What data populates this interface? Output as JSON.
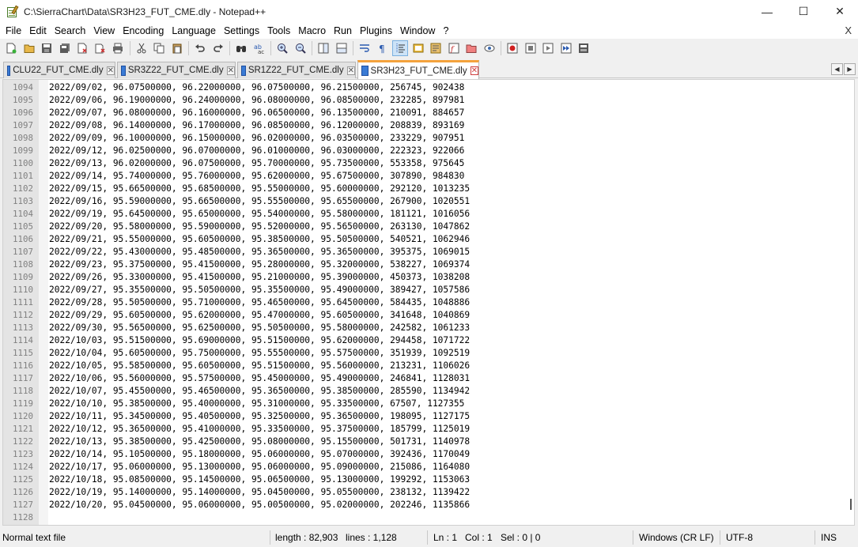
{
  "window": {
    "title": "C:\\SierraChart\\Data\\SR3H23_FUT_CME.dly - Notepad++",
    "minimize_glyph": "—",
    "maximize_glyph": "☐",
    "close_glyph": "✕"
  },
  "menu": {
    "items": [
      "File",
      "Edit",
      "Search",
      "View",
      "Encoding",
      "Language",
      "Settings",
      "Tools",
      "Macro",
      "Run",
      "Plugins",
      "Window",
      "?"
    ],
    "close_label": "X"
  },
  "toolbar": {
    "buttons": [
      "new-file",
      "open-file",
      "save",
      "save-all",
      "close",
      "close-all",
      "print",
      "cut",
      "copy",
      "paste",
      "undo",
      "redo",
      "find",
      "replace",
      "zoom-in",
      "zoom-out",
      "sync-vertical",
      "sync-horizontal",
      "word-wrap",
      "show-all-chars",
      "indent-guide",
      "define-language",
      "document-map",
      "function-list",
      "folder-workspace",
      "monitoring",
      "record-macro",
      "stop-recording",
      "playback-macro",
      "run-macro-multiple",
      "save-macro"
    ]
  },
  "tabs": [
    {
      "label": "CLU22_FUT_CME.dly",
      "active": false
    },
    {
      "label": "SR3Z22_FUT_CME.dly",
      "active": false
    },
    {
      "label": "SR1Z22_FUT_CME.dly",
      "active": false
    },
    {
      "label": "SR3H23_FUT_CME.dly",
      "active": true
    }
  ],
  "tab_scroll": {
    "left": "◀",
    "right": "▶"
  },
  "editor": {
    "lines": [
      {
        "no": "1094",
        "text": "2022/09/02, 96.07500000, 96.22000000, 96.07500000, 96.21500000, 256745, 902438"
      },
      {
        "no": "1095",
        "text": "2022/09/06, 96.19000000, 96.24000000, 96.08000000, 96.08500000, 232285, 897981"
      },
      {
        "no": "1096",
        "text": "2022/09/07, 96.08000000, 96.16000000, 96.06500000, 96.13500000, 210091, 884657"
      },
      {
        "no": "1097",
        "text": "2022/09/08, 96.14000000, 96.17000000, 96.08500000, 96.12000000, 208839, 893169"
      },
      {
        "no": "1098",
        "text": "2022/09/09, 96.10000000, 96.15000000, 96.02000000, 96.03500000, 233229, 907951"
      },
      {
        "no": "1099",
        "text": "2022/09/12, 96.02500000, 96.07000000, 96.01000000, 96.03000000, 222323, 922066"
      },
      {
        "no": "1100",
        "text": "2022/09/13, 96.02000000, 96.07500000, 95.70000000, 95.73500000, 553358, 975645"
      },
      {
        "no": "1101",
        "text": "2022/09/14, 95.74000000, 95.76000000, 95.62000000, 95.67500000, 307890, 984830"
      },
      {
        "no": "1102",
        "text": "2022/09/15, 95.66500000, 95.68500000, 95.55000000, 95.60000000, 292120, 1013235"
      },
      {
        "no": "1103",
        "text": "2022/09/16, 95.59000000, 95.66500000, 95.55500000, 95.65500000, 267900, 1020551"
      },
      {
        "no": "1104",
        "text": "2022/09/19, 95.64500000, 95.65000000, 95.54000000, 95.58000000, 181121, 1016056"
      },
      {
        "no": "1105",
        "text": "2022/09/20, 95.58000000, 95.59000000, 95.52000000, 95.56500000, 263130, 1047862"
      },
      {
        "no": "1106",
        "text": "2022/09/21, 95.55000000, 95.60500000, 95.38500000, 95.50500000, 540521, 1062946"
      },
      {
        "no": "1107",
        "text": "2022/09/22, 95.43000000, 95.48500000, 95.36500000, 95.36500000, 395375, 1069015"
      },
      {
        "no": "1108",
        "text": "2022/09/23, 95.37500000, 95.41500000, 95.28000000, 95.32000000, 538227, 1069374"
      },
      {
        "no": "1109",
        "text": "2022/09/26, 95.33000000, 95.41500000, 95.21000000, 95.39000000, 450373, 1038208"
      },
      {
        "no": "1110",
        "text": "2022/09/27, 95.35500000, 95.50500000, 95.35500000, 95.49000000, 389427, 1057586"
      },
      {
        "no": "1111",
        "text": "2022/09/28, 95.50500000, 95.71000000, 95.46500000, 95.64500000, 584435, 1048886"
      },
      {
        "no": "1112",
        "text": "2022/09/29, 95.60500000, 95.62000000, 95.47000000, 95.60500000, 341648, 1040869"
      },
      {
        "no": "1113",
        "text": "2022/09/30, 95.56500000, 95.62500000, 95.50500000, 95.58000000, 242582, 1061233"
      },
      {
        "no": "1114",
        "text": "2022/10/03, 95.51500000, 95.69000000, 95.51500000, 95.62000000, 294458, 1071722"
      },
      {
        "no": "1115",
        "text": "2022/10/04, 95.60500000, 95.75000000, 95.55500000, 95.57500000, 351939, 1092519"
      },
      {
        "no": "1116",
        "text": "2022/10/05, 95.58500000, 95.60500000, 95.51500000, 95.56000000, 213231, 1106026"
      },
      {
        "no": "1117",
        "text": "2022/10/06, 95.56000000, 95.57500000, 95.45000000, 95.49000000, 246841, 1128031"
      },
      {
        "no": "1118",
        "text": "2022/10/07, 95.45500000, 95.46500000, 95.36500000, 95.38500000, 285590, 1134942"
      },
      {
        "no": "1119",
        "text": "2022/10/10, 95.38500000, 95.40000000, 95.31000000, 95.33500000, 67507, 1127355"
      },
      {
        "no": "1120",
        "text": "2022/10/11, 95.34500000, 95.40500000, 95.32500000, 95.36500000, 198095, 1127175"
      },
      {
        "no": "1121",
        "text": "2022/10/12, 95.36500000, 95.41000000, 95.33500000, 95.37500000, 185799, 1125019"
      },
      {
        "no": "1122",
        "text": "2022/10/13, 95.38500000, 95.42500000, 95.08000000, 95.15500000, 501731, 1140978"
      },
      {
        "no": "1123",
        "text": "2022/10/14, 95.10500000, 95.18000000, 95.06000000, 95.07000000, 392436, 1170049"
      },
      {
        "no": "1124",
        "text": "2022/10/17, 95.06000000, 95.13000000, 95.06000000, 95.09000000, 215086, 1164080"
      },
      {
        "no": "1125",
        "text": "2022/10/18, 95.08500000, 95.14500000, 95.06500000, 95.13000000, 199292, 1153063"
      },
      {
        "no": "1126",
        "text": "2022/10/19, 95.14000000, 95.14000000, 95.04500000, 95.05500000, 238132, 1139422"
      },
      {
        "no": "1127",
        "text": "2022/10/20, 95.04500000, 95.06000000, 95.00500000, 95.02000000, 202246, 1135866"
      },
      {
        "no": "1128",
        "text": ""
      }
    ]
  },
  "status": {
    "file_type": "Normal text file",
    "length": "length : 82,903",
    "lines": "lines : 1,128",
    "ln": "Ln : 1",
    "col": "Col : 1",
    "sel": "Sel : 0 | 0",
    "eol": "Windows (CR LF)",
    "encoding": "UTF-8",
    "mode": "INS"
  }
}
